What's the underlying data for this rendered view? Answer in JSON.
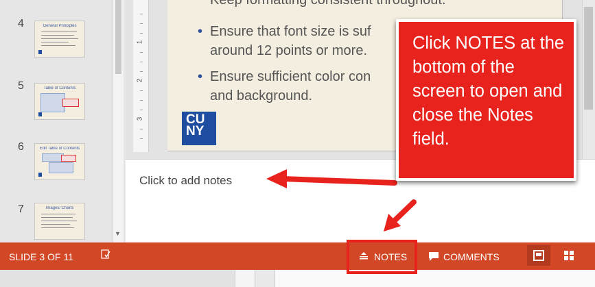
{
  "thumbnails": [
    {
      "number": "4",
      "title": "General Principles"
    },
    {
      "number": "5",
      "title": "Table of Contents"
    },
    {
      "number": "6",
      "title": "Edit Table of Contents"
    },
    {
      "number": "7",
      "title": "Images/ Charts"
    }
  ],
  "slide": {
    "bullets": [
      "Keep formatting consistent throughout.",
      "Ensure that font size is suf",
      "around 12 points or more.",
      "Ensure sufficient color con",
      "and background."
    ],
    "logo_text_line1": "CU",
    "logo_text_line2": "NY"
  },
  "ruler": {
    "marks": [
      "1",
      "2",
      "3"
    ]
  },
  "notes": {
    "placeholder": "Click to add notes"
  },
  "status_bar": {
    "slide_indicator": "SLIDE 3 OF 11",
    "notes_label": "NOTES",
    "comments_label": "COMMENTS",
    "background_color": "#d24726"
  },
  "callout": {
    "text": "Click NOTES at the bottom of the screen to open and close the Notes field.",
    "color": "#e8231d"
  },
  "icons": {
    "spell_check": "spell-check-icon",
    "notes": "notes-icon",
    "comments": "comment-icon",
    "normal_view": "normal-view-icon",
    "slide_sorter": "slide-sorter-icon"
  }
}
